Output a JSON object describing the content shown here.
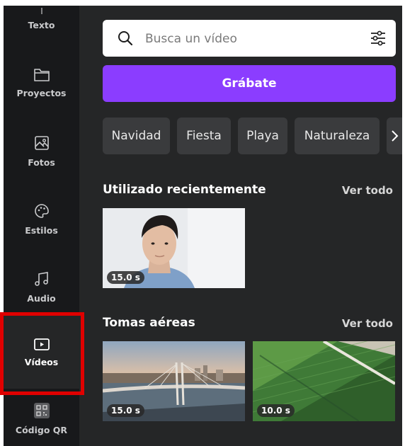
{
  "sidebar": {
    "items": [
      {
        "label": "Texto",
        "icon": "text-icon"
      },
      {
        "label": "Proyectos",
        "icon": "folder-icon"
      },
      {
        "label": "Fotos",
        "icon": "image-icon"
      },
      {
        "label": "Estilos",
        "icon": "palette-icon"
      },
      {
        "label": "Audio",
        "icon": "music-note-icon"
      },
      {
        "label": "Vídeos",
        "icon": "video-play-icon",
        "active": true
      },
      {
        "label": "Código QR",
        "icon": "qr-code-icon"
      }
    ]
  },
  "search": {
    "placeholder": "Busca un vídeo"
  },
  "record_button": {
    "label": "Grábate"
  },
  "chips": [
    "Navidad",
    "Fiesta",
    "Playa",
    "Naturaleza"
  ],
  "sections": {
    "recent": {
      "title": "Utilizado recientemente",
      "see_all": "Ver todo",
      "items": [
        {
          "duration": "15.0 s"
        }
      ]
    },
    "aerial": {
      "title": "Tomas aéreas",
      "see_all": "Ver todo",
      "items": [
        {
          "duration": "15.0 s"
        },
        {
          "duration": "10.0 s"
        }
      ]
    }
  },
  "colors": {
    "accent": "#8b3dff",
    "highlight": "#e00000"
  }
}
